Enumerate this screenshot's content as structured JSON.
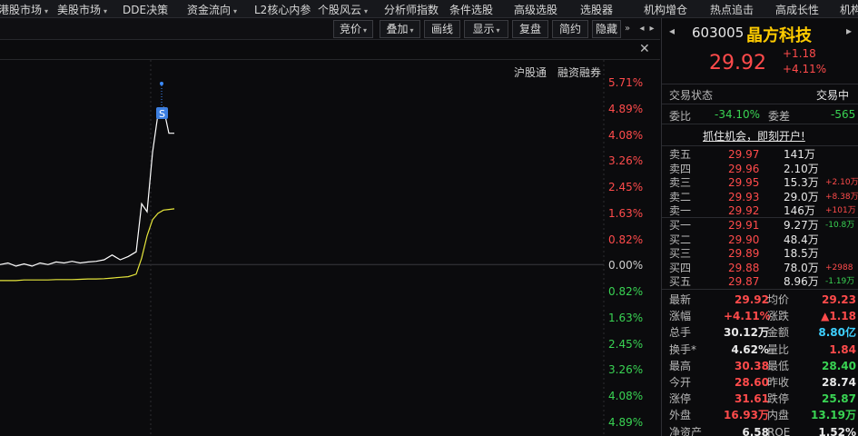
{
  "menu": [
    {
      "label": "港股市场",
      "dropdown": true
    },
    {
      "label": "美股市场",
      "dropdown": true
    },
    {
      "label": "DDE决策",
      "dropdown": false
    },
    {
      "label": "资金流向",
      "dropdown": true
    },
    {
      "label": "L2核心内参",
      "dropdown": false
    },
    {
      "label": "个股风云",
      "dropdown": true
    },
    {
      "label": "分析师指数",
      "dropdown": false
    },
    {
      "label": "条件选股",
      "dropdown": false
    },
    {
      "label": "高级选股",
      "dropdown": false
    },
    {
      "label": "选股器",
      "dropdown": false
    },
    {
      "label": "机构增仓",
      "dropdown": false
    },
    {
      "label": "热点追击",
      "dropdown": false
    },
    {
      "label": "高成长性",
      "dropdown": false
    },
    {
      "label": "机构",
      "dropdown": false
    }
  ],
  "toolbar": {
    "buttons": [
      {
        "label": "竞价",
        "dropdown": true
      },
      {
        "label": "叠加",
        "dropdown": true
      },
      {
        "label": "画线",
        "dropdown": false
      },
      {
        "label": "显示",
        "dropdown": true
      },
      {
        "label": "复盘",
        "dropdown": false
      },
      {
        "label": "简约",
        "dropdown": false
      },
      {
        "label": "隐藏",
        "dropdown": false
      }
    ],
    "more_icon": "double-chevron-right-icon",
    "prev_icon": "triangle-left-icon",
    "next_icon": "triangle-right-icon",
    "close_icon": "close-icon"
  },
  "chart_tags": [
    "沪股通",
    "融资融券"
  ],
  "chart_data": {
    "type": "line",
    "title": "",
    "xlabel": "",
    "ylabel": "",
    "y_axis_labels": [
      "5.71%",
      "4.89%",
      "4.08%",
      "3.26%",
      "2.45%",
      "1.63%",
      "0.82%",
      "0.00%",
      "0.82%",
      "1.63%",
      "2.45%",
      "3.26%",
      "4.08%",
      "4.89%"
    ],
    "ylim": [
      -5.71,
      5.71
    ],
    "marker_label": "S",
    "series": [
      {
        "color": "#ffffff",
        "values": [
          0.0,
          0.05,
          -0.05,
          0.02,
          -0.05,
          0.05,
          0.0,
          0.08,
          0.05,
          0.1,
          0.05,
          0.08,
          0.1,
          0.15,
          0.3,
          0.15,
          0.25,
          0.4,
          1.9,
          1.65,
          3.5,
          4.7,
          4.9,
          4.1,
          4.1
        ]
      },
      {
        "color": "#e6e63c",
        "values": [
          -0.5,
          -0.5,
          -0.5,
          -0.48,
          -0.48,
          -0.48,
          -0.48,
          -0.47,
          -0.47,
          -0.47,
          -0.46,
          -0.45,
          -0.45,
          -0.44,
          -0.42,
          -0.4,
          -0.38,
          -0.3,
          0.2,
          0.9,
          1.4,
          1.6,
          1.7,
          1.72,
          1.74
        ]
      }
    ]
  },
  "quote": {
    "code": "603005",
    "name": "晶方科技",
    "price": "29.92",
    "change": "+1.18",
    "change_pct": "+4.11%",
    "trade_status_label": "交易状态",
    "trade_status": "交易中",
    "weibi_label": "委比",
    "weibi": "-34.10%",
    "weicha_label": "委差",
    "weicha": "-565",
    "promo": "抓住机会，即刻开户!"
  },
  "orderbook": {
    "asks": [
      {
        "label": "卖五",
        "price": "29.97",
        "vol": "141万",
        "delta": ""
      },
      {
        "label": "卖四",
        "price": "29.96",
        "vol": "2.10万",
        "delta": ""
      },
      {
        "label": "卖三",
        "price": "29.95",
        "vol": "15.3万",
        "delta": "+2.10万"
      },
      {
        "label": "卖二",
        "price": "29.93",
        "vol": "29.0万",
        "delta": "+8.38万"
      },
      {
        "label": "卖一",
        "price": "29.92",
        "vol": "146万",
        "delta": "+101万"
      }
    ],
    "bids": [
      {
        "label": "买一",
        "price": "29.91",
        "vol": "9.27万",
        "delta": "-10.8万"
      },
      {
        "label": "买二",
        "price": "29.90",
        "vol": "48.4万",
        "delta": ""
      },
      {
        "label": "买三",
        "price": "29.89",
        "vol": "18.5万",
        "delta": ""
      },
      {
        "label": "买四",
        "price": "29.88",
        "vol": "78.0万",
        "delta": "+2988"
      },
      {
        "label": "买五",
        "price": "29.87",
        "vol": "8.96万",
        "delta": "-1.19万"
      }
    ]
  },
  "stats": [
    {
      "l1": "最新",
      "v1": "29.92",
      "c1": "red",
      "l2": "均价",
      "v2": "29.23",
      "c2": "red"
    },
    {
      "l1": "涨幅",
      "v1": "+4.11%",
      "c1": "red",
      "l2": "涨跌",
      "v2": "▲1.18",
      "c2": "red"
    },
    {
      "l1": "总手",
      "v1": "30.12万",
      "c1": "white",
      "l2": "金额",
      "v2": "8.80亿",
      "c2": "cyan"
    },
    {
      "l1": "换手*",
      "v1": "4.62%",
      "c1": "white",
      "l2": "量比",
      "v2": "1.84",
      "c2": "red"
    },
    {
      "l1": "最高",
      "v1": "30.38",
      "c1": "red",
      "l2": "最低",
      "v2": "28.40",
      "c2": "green"
    },
    {
      "l1": "今开",
      "v1": "28.60",
      "c1": "red",
      "l2": "昨收",
      "v2": "28.74",
      "c2": "white"
    },
    {
      "l1": "涨停",
      "v1": "31.61",
      "c1": "red",
      "l2": "跌停",
      "v2": "25.87",
      "c2": "green"
    },
    {
      "l1": "外盘",
      "v1": "16.93万",
      "c1": "red",
      "l2": "内盘",
      "v2": "13.19万",
      "c2": "green"
    },
    {
      "l1": "净资产",
      "v1": "6.58",
      "c1": "white",
      "l2": "ROE",
      "v2": "1.52%",
      "c2": "white"
    }
  ],
  "colors": {
    "up": "#ff4b4b",
    "down": "#39d353",
    "accent_name": "#ffcc00",
    "price_line": "#ffffff",
    "avg_line": "#e6e63c"
  }
}
